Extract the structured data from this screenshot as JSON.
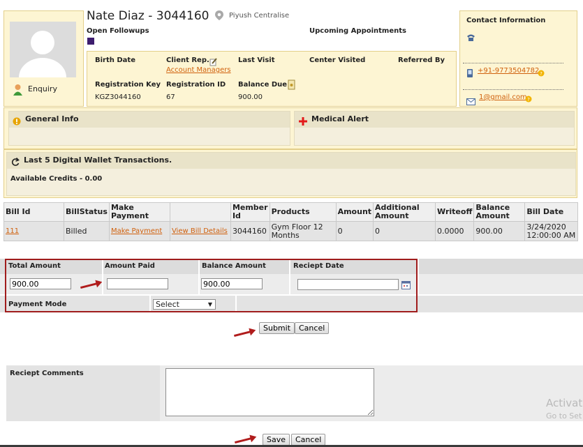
{
  "client": {
    "name_id": "Nate Diaz - 3044160",
    "center": "Piyush Centralise",
    "status": "Enquiry",
    "open_followups_label": "Open Followups",
    "upcoming_appointments_label": "Upcoming Appointments"
  },
  "details": {
    "birth_date_label": "Birth Date",
    "client_rep_label": "Client Rep.",
    "client_rep_link": "Account Managers",
    "last_visit_label": "Last Visit",
    "center_visited_label": "Center Visited",
    "referred_by_label": "Referred By",
    "registration_key_label": "Registration Key",
    "registration_key_value": "KGZ3044160",
    "registration_id_label": "Registration ID",
    "registration_id_value": "67",
    "balance_due_label": "Balance Due",
    "balance_due_value": "900.00"
  },
  "contact": {
    "title": "Contact Information",
    "phone": "+91-9773504782",
    "email": "1@gmail.com"
  },
  "sections": {
    "general_info": "General Info",
    "medical_alert": "Medical Alert",
    "wallet_title": "Last 5 Digital Wallet Transactions.",
    "available_credits": "Available Credits - 0.00"
  },
  "bills_table": {
    "headers": [
      "Bill Id",
      "BillStatus",
      "Make Payment",
      "",
      "Member Id",
      "Products",
      "Amount",
      "Additional Amount",
      "Writeoff",
      "Balance Amount",
      "Bill Date"
    ],
    "row": {
      "bill_id": "111",
      "status": "Billed",
      "make_payment": "Make Payment",
      "view_details": "View Bill Details",
      "member_id": "3044160",
      "products": "Gym Floor 12 Months",
      "amount": "0",
      "additional_amount": "0",
      "writeoff": "0.0000",
      "balance_amount": "900.00",
      "bill_date": "3/24/2020 12:00:00 AM"
    }
  },
  "payment_form": {
    "total_amount_label": "Total Amount",
    "amount_paid_label": "Amount Paid",
    "balance_amount_label": "Balance Amount",
    "receipt_date_label": "Reciept Date",
    "total_amount_value": "900.00",
    "amount_paid_value": "",
    "balance_amount_value": "900.00",
    "receipt_date_value": "",
    "payment_mode_label": "Payment Mode",
    "payment_mode_selected": "Select",
    "submit_label": "Submit",
    "cancel_label": "Cancel"
  },
  "comments": {
    "label": "Reciept Comments",
    "save_label": "Save",
    "cancel_label": "Cancel"
  },
  "watermark": {
    "line1": "Activat",
    "line2": "Go to Set"
  },
  "colors": {
    "accent_link": "#d0600c",
    "highlight_border": "#a01c1c",
    "panel_yellow": "#fdf5d3"
  }
}
